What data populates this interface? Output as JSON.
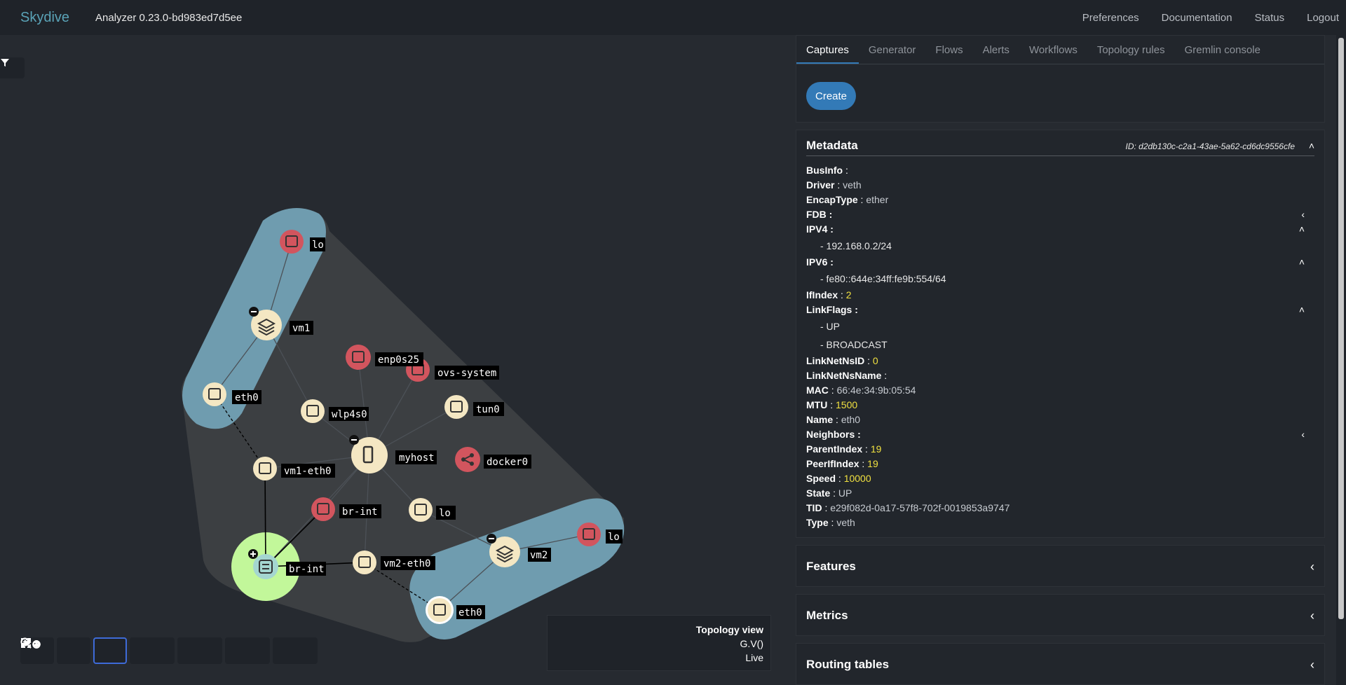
{
  "navbar": {
    "brand": "Skydive",
    "version": "Analyzer 0.23.0-bd983ed7d5ee",
    "links": [
      "Preferences",
      "Documentation",
      "Status",
      "Logout"
    ]
  },
  "topology": {
    "nodes": {
      "lo_vm1": "lo",
      "vm1": "vm1",
      "eth0_vm1": "eth0",
      "enp0s25": "enp0s25",
      "ovs_system": "ovs-system",
      "wlp4s0": "wlp4s0",
      "tun0": "tun0",
      "myhost": "myhost",
      "docker0": "docker0",
      "vm1_eth0": "vm1-eth0",
      "br_int_red": "br-int",
      "lo_host": "lo",
      "br_int_ovs": "br-int",
      "vm2_eth0": "vm2-eth0",
      "vm2": "vm2",
      "lo_vm2": "lo",
      "eth0_vm2": "eth0"
    },
    "info": {
      "title": "Topology view",
      "query": "G.V()",
      "mode": "Live"
    },
    "toolbar_icons": [
      "zoom-in-icon",
      "zoom-out-icon",
      "fit-icon",
      "expand-all-icon",
      "collapse-all-icon",
      "pin-all-icon",
      "unpin-all-icon"
    ]
  },
  "tabs": [
    "Captures",
    "Generator",
    "Flows",
    "Alerts",
    "Workflows",
    "Topology rules",
    "Gremlin console"
  ],
  "captures": {
    "create_label": "Create"
  },
  "metadata": {
    "title": "Metadata",
    "id": "ID: d2db130c-c2a1-43ae-5a62-cd6dc9556cfe",
    "rows": [
      {
        "k": "BusInfo",
        "v": ""
      },
      {
        "k": "Driver",
        "v": "veth"
      },
      {
        "k": "EncapType",
        "v": "ether"
      },
      {
        "k": "FDB",
        "v": ""
      },
      {
        "k": "IPV4",
        "v": ""
      },
      {
        "k": "IPV4_item",
        "v": "- 192.168.0.2/24"
      },
      {
        "k": "IPV6",
        "v": ""
      },
      {
        "k": "IPV6_item",
        "v": "- fe80::644e:34ff:fe9b:554/64"
      },
      {
        "k": "IfIndex",
        "v": "2"
      },
      {
        "k": "LinkFlags",
        "v": ""
      },
      {
        "k": "LinkFlags_1",
        "v": "- UP"
      },
      {
        "k": "LinkFlags_2",
        "v": "- BROADCAST"
      },
      {
        "k": "LinkNetNsID",
        "v": "0"
      },
      {
        "k": "LinkNetNsName",
        "v": ""
      },
      {
        "k": "MAC",
        "v": "66:4e:34:9b:05:54"
      },
      {
        "k": "MTU",
        "v": "1500"
      },
      {
        "k": "Name",
        "v": "eth0"
      },
      {
        "k": "Neighbors",
        "v": ""
      },
      {
        "k": "ParentIndex",
        "v": "19"
      },
      {
        "k": "PeerIfIndex",
        "v": "19"
      },
      {
        "k": "Speed",
        "v": "10000"
      },
      {
        "k": "State",
        "v": "UP"
      },
      {
        "k": "TID",
        "v": "e29f082d-0a17-57f8-702f-0019853a9747"
      },
      {
        "k": "Type",
        "v": "veth"
      }
    ]
  },
  "sections": {
    "features": "Features",
    "metrics": "Metrics",
    "routing": "Routing tables"
  },
  "colors": {
    "accent": "#337ab7",
    "vm_group": "#6f9caf",
    "host_group": "#3d4043",
    "node_cream": "#f4e7c3",
    "node_red": "#d2555e",
    "node_green": "#c2f79a"
  }
}
